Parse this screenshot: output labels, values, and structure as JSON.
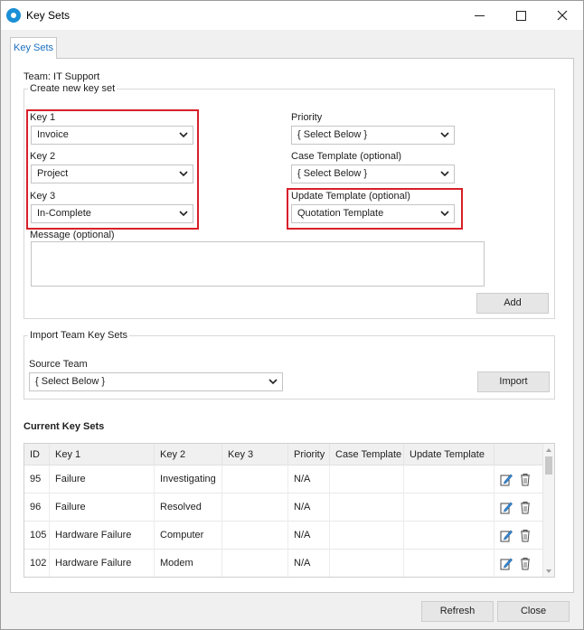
{
  "window": {
    "title": "Key Sets"
  },
  "tabs": [
    {
      "label": "Key Sets"
    }
  ],
  "team_line": "Team:  IT Support",
  "create": {
    "group_title": "Create new key set",
    "key1": {
      "label": "Key 1",
      "value": "Invoice"
    },
    "key2": {
      "label": "Key 2",
      "value": "Project"
    },
    "key3": {
      "label": "Key 3",
      "value": "In-Complete"
    },
    "priority": {
      "label": "Priority",
      "value": "{ Select Below }"
    },
    "case_template": {
      "label": "Case Template (optional)",
      "value": "{ Select Below }"
    },
    "update_template": {
      "label": "Update Template (optional)",
      "value": "Quotation Template"
    },
    "message": {
      "label": "Message (optional)",
      "value": ""
    },
    "add_label": "Add"
  },
  "import": {
    "group_title": "Import Team Key Sets",
    "source_label": "Source Team",
    "source_value": "{ Select Below }",
    "import_label": "Import"
  },
  "current": {
    "title": "Current Key Sets",
    "columns": [
      "ID",
      "Key 1",
      "Key 2",
      "Key 3",
      "Priority",
      "Case Template",
      "Update Template"
    ],
    "rows": [
      {
        "id": "95",
        "key1": "Failure",
        "key2": "Investigating",
        "key3": "",
        "priority": "N/A",
        "case_template": "",
        "update_template": ""
      },
      {
        "id": "96",
        "key1": "Failure",
        "key2": "Resolved",
        "key3": "",
        "priority": "N/A",
        "case_template": "",
        "update_template": ""
      },
      {
        "id": "105",
        "key1": "Hardware Failure",
        "key2": "Computer",
        "key3": "",
        "priority": "N/A",
        "case_template": "",
        "update_template": ""
      },
      {
        "id": "102",
        "key1": "Hardware Failure",
        "key2": "Modem",
        "key3": "",
        "priority": "N/A",
        "case_template": "",
        "update_template": ""
      }
    ]
  },
  "footer": {
    "refresh_label": "Refresh",
    "close_label": "Close"
  },
  "colors": {
    "highlight": "#d8202a",
    "tab_text": "#1a6fc0",
    "icon_blue": "#1b8fd6"
  },
  "icons": {
    "edit": "edit-pencil-icon",
    "delete": "trash-icon",
    "dropdown": "chevron-down-icon"
  }
}
